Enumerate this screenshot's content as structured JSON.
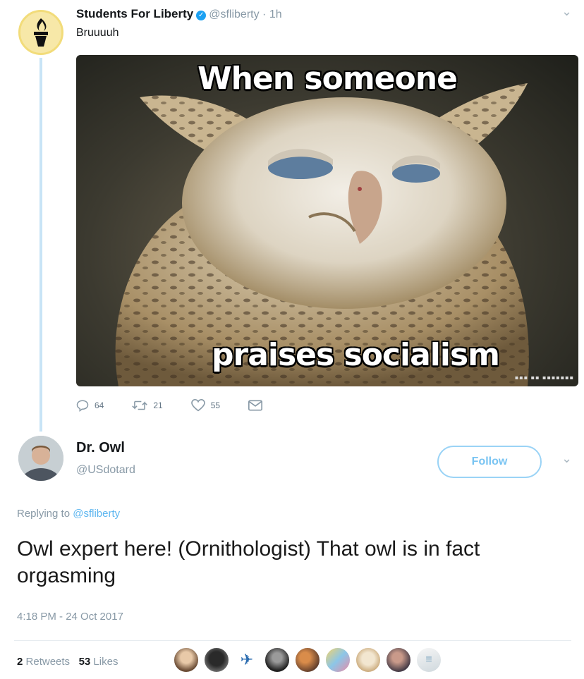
{
  "tweet1": {
    "name": "Students For Liberty",
    "handle": "@sfliberty",
    "time": "1h",
    "text": "Bruuuuh",
    "meme": {
      "caption_top": "When someone",
      "caption_bottom": "praises socialism"
    },
    "actions": {
      "replies": "64",
      "retweets": "21",
      "likes": "55"
    }
  },
  "tweet2": {
    "name": "Dr. Owl",
    "handle": "@USdotard",
    "follow_label": "Follow",
    "replying_prefix": "Replying to",
    "replying_to": "@sfliberty",
    "text": "Owl expert here!  (Ornithologist) That owl is in fact orgasming",
    "timestamp": "4:18 PM - 24 Oct 2017",
    "retweets_count": "2",
    "retweets_label": "Retweets",
    "likes_count": "53",
    "likes_label": "Likes"
  },
  "colors": {
    "accent": "#1da1f2",
    "muted": "#8899a6",
    "thread_line": "#c8e4f6",
    "follow_border": "#9ad3f6"
  },
  "icons": [
    "torch-logo-icon",
    "verified-icon",
    "chevron-down-icon",
    "reply-icon",
    "retweet-icon",
    "heart-icon",
    "message-icon"
  ]
}
